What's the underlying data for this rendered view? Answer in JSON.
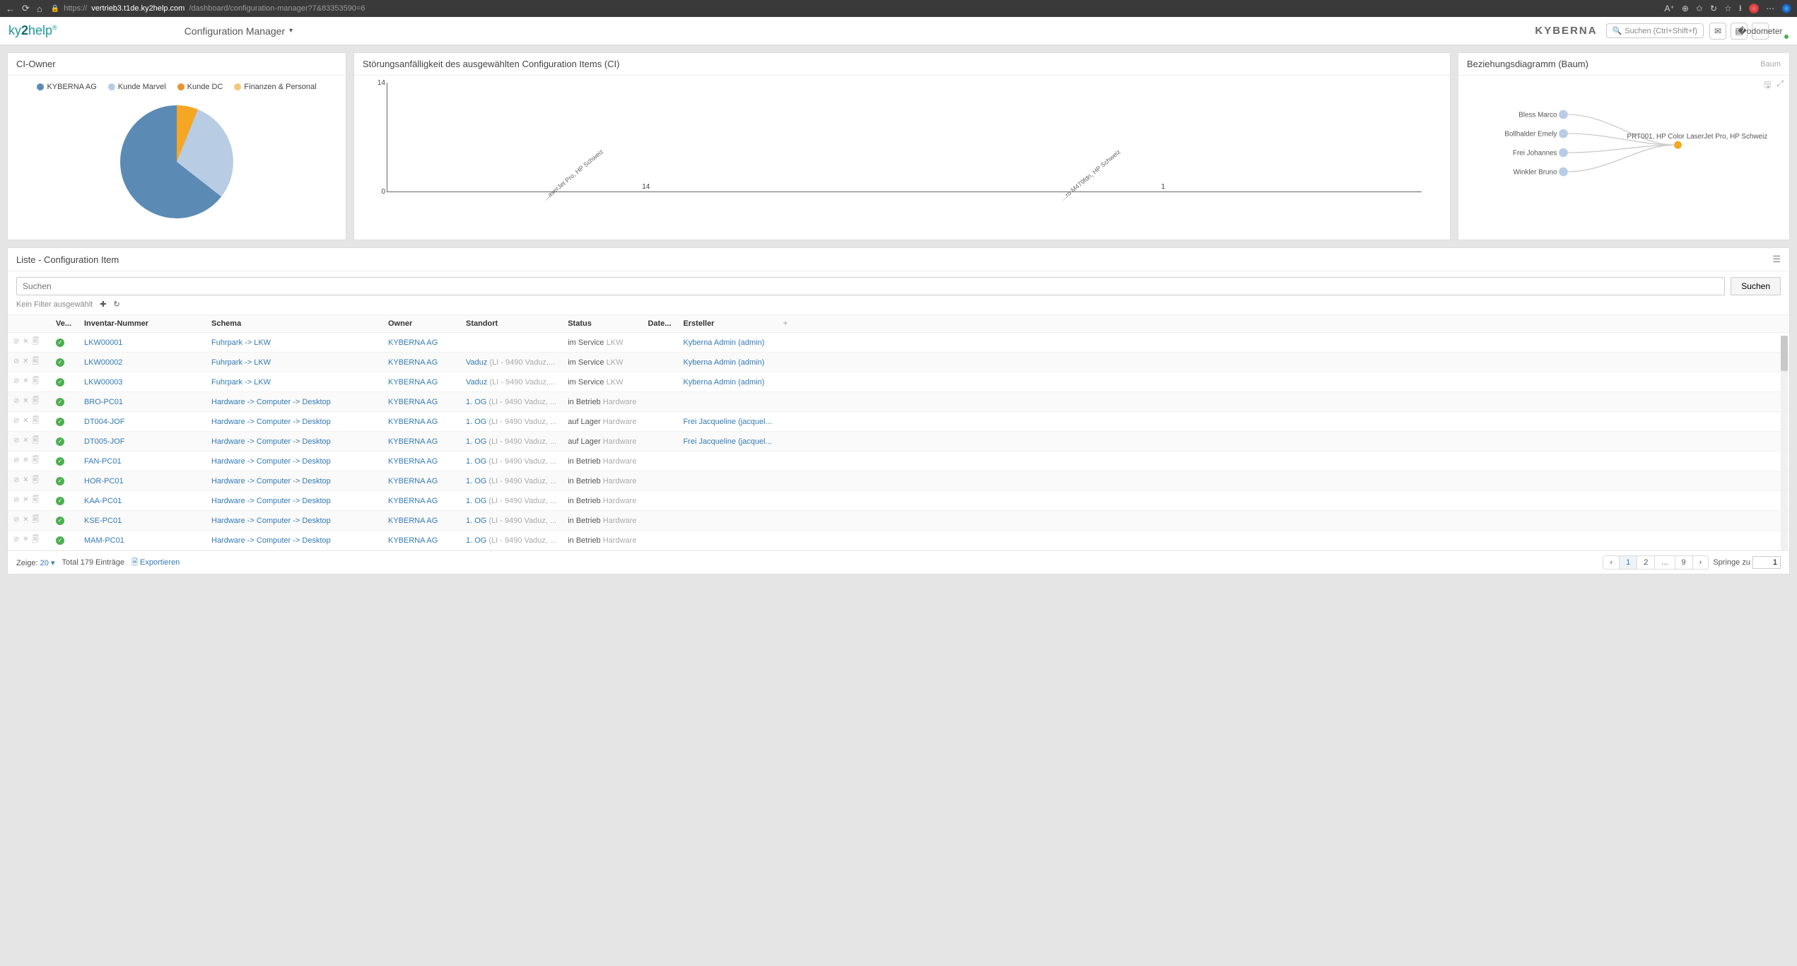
{
  "browser": {
    "url": "https://vertrieb3.t1de.ky2help.com/dashboard/configuration-manager?7&83353590=6",
    "url_host": "vertrieb3.t1de.ky2help.com",
    "url_path": "/dashboard/configuration-manager?7&83353590=6"
  },
  "header": {
    "logo_pre": "ky",
    "logo_mid": "2",
    "logo_post": "help",
    "page_title": "Configuration Manager",
    "brand": "KYBERNA",
    "search_placeholder": "Suchen (Ctrl+Shift+f)"
  },
  "panels": {
    "ci_owner": {
      "title": "CI-Owner",
      "legend": [
        {
          "label": "KYBERNA AG",
          "color": "#5b8bb5"
        },
        {
          "label": "Kunde Marvel",
          "color": "#b8cce4"
        },
        {
          "label": "Kunde DC",
          "color": "#e9952e"
        },
        {
          "label": "Finanzen & Personal",
          "color": "#f5c77e"
        }
      ]
    },
    "stoer": {
      "title": "Störungsanfälligkeit des ausgewählten Configuration Items (CI)"
    },
    "diagram": {
      "title": "Beziehungsdiagramm (Baum)",
      "mode": "Baum",
      "nodes": [
        "Bless Marco",
        "Bollhalder Emely",
        "Frei Johannes",
        "Winkler Bruno"
      ],
      "target": "PRT001, HP Color LaserJet Pro, HP Schweiz"
    }
  },
  "chart_data": [
    {
      "type": "pie",
      "title": "CI-Owner",
      "series": [
        {
          "name": "KYBERNA AG",
          "value": 64
        },
        {
          "name": "Kunde Marvel",
          "value": 30
        },
        {
          "name": "Finanzen & Personal",
          "value": 4
        },
        {
          "name": "Kunde DC",
          "value": 2
        }
      ]
    },
    {
      "type": "bar",
      "title": "Störungsanfälligkeit des ausgewählten Configuration Items (CI)",
      "categories": [
        "...aserJet Pro, HP Schweiz",
        "...ro M479fdn, HP Schweiz"
      ],
      "values": [
        14,
        1
      ],
      "ylim": [
        0,
        14
      ],
      "ylabel": "",
      "xlabel": ""
    }
  ],
  "list": {
    "title": "Liste - Configuration Item",
    "search_placeholder": "Suchen",
    "search_button": "Suchen",
    "no_filter": "Kein Filter ausgewählt",
    "columns": {
      "valid": "Ve...",
      "inventar": "Inventar-Nummer",
      "schema": "Schema",
      "owner": "Owner",
      "standort": "Standort",
      "status": "Status",
      "date": "Date...",
      "ersteller": "Ersteller"
    },
    "rows": [
      {
        "inv": "LKW00001",
        "schema": "Fuhrpark -> LKW",
        "owner": "KYBERNA AG",
        "standort": "",
        "standort_sub": "",
        "status": "im Service",
        "status_sub": "LKW",
        "ersteller": "Kyberna Admin (admin)"
      },
      {
        "inv": "LKW00002",
        "schema": "Fuhrpark -> LKW",
        "owner": "KYBERNA AG",
        "standort": "Vaduz",
        "standort_sub": "(LI - 9490 Vaduz,...",
        "status": "im Service",
        "status_sub": "LKW",
        "ersteller": "Kyberna Admin (admin)"
      },
      {
        "inv": "LKW00003",
        "schema": "Fuhrpark -> LKW",
        "owner": "KYBERNA AG",
        "standort": "Vaduz",
        "standort_sub": "(LI - 9490 Vaduz,...",
        "status": "im Service",
        "status_sub": "LKW",
        "ersteller": "Kyberna Admin (admin)"
      },
      {
        "inv": "BRO-PC01",
        "schema": "Hardware -> Computer -> Desktop",
        "owner": "KYBERNA AG",
        "standort": "1. OG",
        "standort_sub": "(LI - 9490 Vaduz, ...",
        "status": "in Betrieb",
        "status_sub": "Hardware",
        "ersteller": ""
      },
      {
        "inv": "DT004-JOF",
        "schema": "Hardware -> Computer -> Desktop",
        "owner": "KYBERNA AG",
        "standort": "1. OG",
        "standort_sub": "(LI - 9490 Vaduz, ...",
        "status": "auf Lager",
        "status_sub": "Hardware",
        "ersteller": "Frei Jacqueline (jacquel..."
      },
      {
        "inv": "DT005-JOF",
        "schema": "Hardware -> Computer -> Desktop",
        "owner": "KYBERNA AG",
        "standort": "1. OG",
        "standort_sub": "(LI - 9490 Vaduz, ...",
        "status": "auf Lager",
        "status_sub": "Hardware",
        "ersteller": "Frei Jacqueline (jacquel..."
      },
      {
        "inv": "FAN-PC01",
        "schema": "Hardware -> Computer -> Desktop",
        "owner": "KYBERNA AG",
        "standort": "1. OG",
        "standort_sub": "(LI - 9490 Vaduz, ...",
        "status": "in Betrieb",
        "status_sub": "Hardware",
        "ersteller": ""
      },
      {
        "inv": "HOR-PC01",
        "schema": "Hardware -> Computer -> Desktop",
        "owner": "KYBERNA AG",
        "standort": "1. OG",
        "standort_sub": "(LI - 9490 Vaduz, ...",
        "status": "in Betrieb",
        "status_sub": "Hardware",
        "ersteller": ""
      },
      {
        "inv": "KAA-PC01",
        "schema": "Hardware -> Computer -> Desktop",
        "owner": "KYBERNA AG",
        "standort": "1. OG",
        "standort_sub": "(LI - 9490 Vaduz, ...",
        "status": "in Betrieb",
        "status_sub": "Hardware",
        "ersteller": ""
      },
      {
        "inv": "KSE-PC01",
        "schema": "Hardware -> Computer -> Desktop",
        "owner": "KYBERNA AG",
        "standort": "1. OG",
        "standort_sub": "(LI - 9490 Vaduz, ...",
        "status": "in Betrieb",
        "status_sub": "Hardware",
        "ersteller": ""
      },
      {
        "inv": "MAM-PC01",
        "schema": "Hardware -> Computer -> Desktop",
        "owner": "KYBERNA AG",
        "standort": "1. OG",
        "standort_sub": "(LI - 9490 Vaduz, ...",
        "status": "in Betrieb",
        "status_sub": "Hardware",
        "ersteller": ""
      }
    ]
  },
  "footer": {
    "show_label": "Zeige:",
    "page_size": "20",
    "total": "Total 179 Einträge",
    "export": "Exportieren",
    "pages": [
      "‹",
      "1",
      "2",
      "...",
      "9",
      "›"
    ],
    "active_page": "1",
    "jump_label": "Springe zu",
    "jump_value": "1"
  }
}
